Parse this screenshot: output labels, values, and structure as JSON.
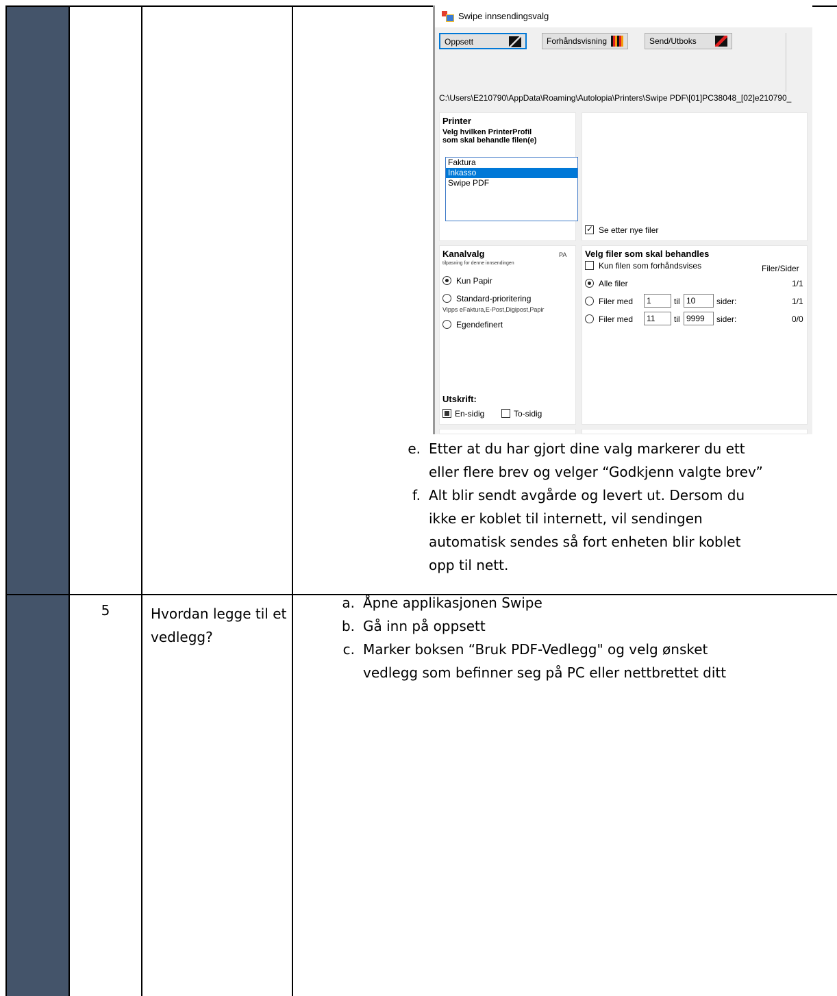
{
  "row1": {
    "items": [
      {
        "marker": "e.",
        "lines": [
          "Etter at du har gjort dine valg markerer du ett",
          "eller flere brev og velger “Godkjenn valgte brev”"
        ]
      },
      {
        "marker": "f.",
        "lines": [
          "Alt blir sendt avgårde og levert ut. Dersom du",
          "ikke er koblet til internett, vil sendingen",
          "automatisk sendes så fort enheten blir koblet",
          "opp til nett."
        ]
      }
    ]
  },
  "row2": {
    "number": "5",
    "question": "Hvordan legge til et vedlegg?",
    "items": [
      {
        "marker": "a.",
        "lines": [
          "Åpne applikasjonen Swipe"
        ]
      },
      {
        "marker": "b.",
        "lines": [
          "Gå inn på oppsett"
        ]
      },
      {
        "marker": "c.",
        "lines": [
          "Marker boksen “Bruk PDF-Vedlegg\" og velg ønsket",
          "vedlegg som befinner seg på PC eller nettbrettet ditt"
        ]
      }
    ]
  },
  "dialog": {
    "title": "Swipe innsendingsvalg",
    "tabs": [
      "Oppsett",
      "Forhåndsvisning",
      "Send/Utboks"
    ],
    "path": "C:\\Users\\E210790\\AppData\\Roaming\\Autolopia\\Printers\\Swipe PDF\\[01]PC38048_[02]e210790_",
    "printer": {
      "title": "Printer",
      "subtitle_line1": "Velg hvilken PrinterProfil",
      "subtitle_line2": "som skal behandle filen(e)",
      "profiles": [
        "Faktura",
        "Inkasso",
        "Swipe PDF"
      ],
      "selected": "Inkasso"
    },
    "watch_label": "Se etter nye filer",
    "channel": {
      "title": "Kanalvalg",
      "badge": "PA",
      "hint": "tilpasning for denne innsendingen",
      "opt_paper": "Kun Papir",
      "opt_standard": "Standard-prioritering",
      "standard_note": "Vipps eFaktura,E-Post,Digipost,Papir",
      "opt_custom": "Egendefinert"
    },
    "print": {
      "title": "Utskrift:",
      "single": "En-sidig",
      "double": "To-sidig"
    },
    "files": {
      "title": "Velg filer som skal behandles",
      "preview_only": "Kun filen som forhåndsvises",
      "col_header": "Filer/Sider",
      "all_files": "Alle filer",
      "all_count": "1/1",
      "range_label": "Filer med",
      "til": "til",
      "sider": "sider:",
      "range1_from": "1",
      "range1_to": "10",
      "range1_count": "1/1",
      "range2_from": "11",
      "range2_to": "9999",
      "range2_count": "0/0"
    }
  }
}
